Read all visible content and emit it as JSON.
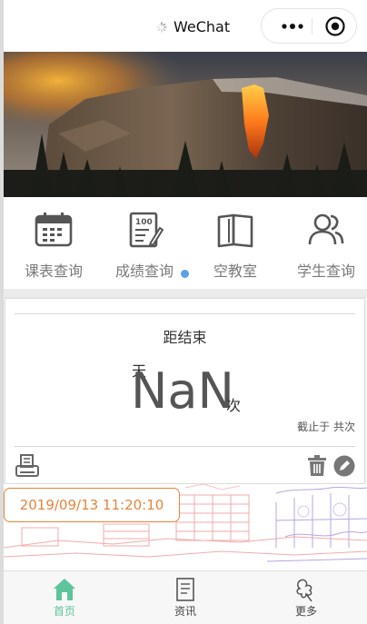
{
  "topbar": {
    "title": "WeChat",
    "menu_icon": "more-dots-icon",
    "close_icon": "target-circle-icon"
  },
  "hero": {
    "image": "mountain-firefall-photo"
  },
  "quick_actions": [
    {
      "label": "课表查询",
      "icon": "calendar-icon"
    },
    {
      "label": "成绩查询",
      "icon": "score-sheet-icon"
    },
    {
      "label": "空教室",
      "icon": "open-book-icon"
    },
    {
      "label": "学生查询",
      "icon": "people-icon"
    }
  ],
  "countdown": {
    "title": "距结束",
    "day_unit": "天",
    "value": "NaN",
    "count_unit": "次",
    "cutoff": "截止于 共次"
  },
  "date_pill": "2019/09/13 11:20:10",
  "tabs": [
    {
      "label": "首页",
      "icon": "home-icon",
      "active": true
    },
    {
      "label": "资讯",
      "icon": "news-icon",
      "active": false
    },
    {
      "label": "更多",
      "icon": "flower-icon",
      "active": false
    }
  ],
  "colors": {
    "accent": "#e8833a",
    "tab_active": "#5cc59a",
    "badge": "#5aa0e6"
  }
}
